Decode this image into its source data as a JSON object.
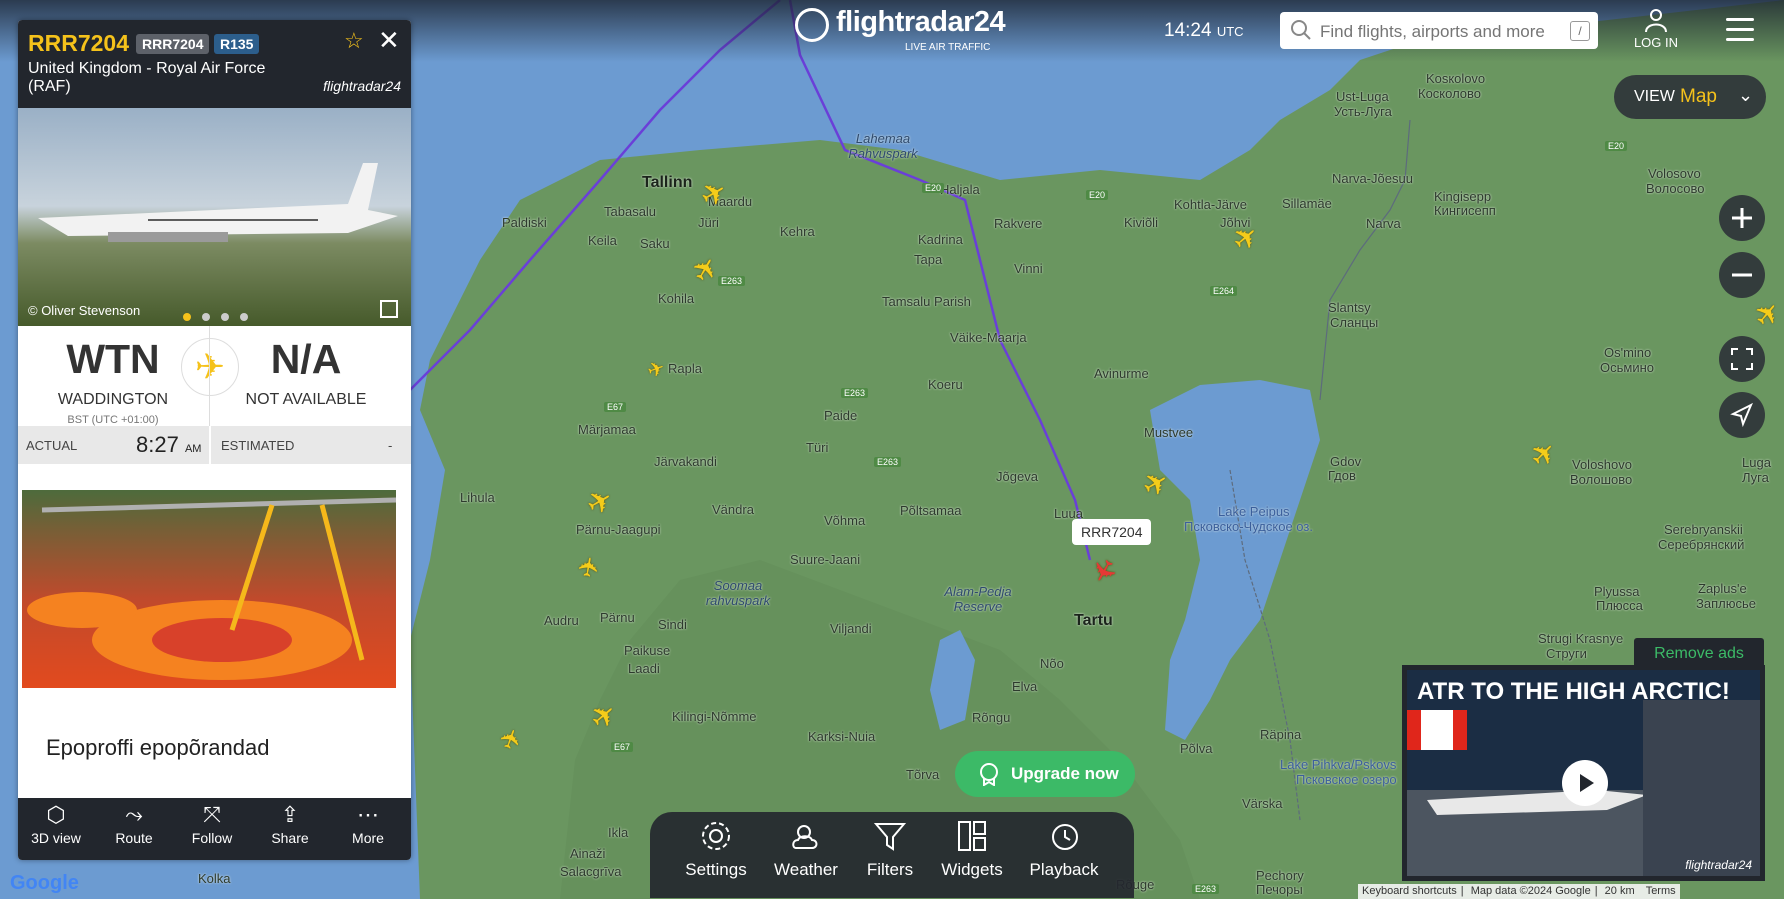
{
  "header": {
    "logo": "flightradar24",
    "logo_sub": "LIVE AIR TRAFFIC",
    "time": "14:24",
    "time_zone": "UTC",
    "search_placeholder": "Find flights, airports and more",
    "search_shortcut": "/",
    "login": "LOG IN"
  },
  "view": {
    "label": "VIEW",
    "value": "Map"
  },
  "flight": {
    "callsign": "RRR7204",
    "reg_tag": "RRR7204",
    "type_tag": "R135",
    "airline": "United Kingdom - Royal Air Force (RAF)",
    "brand": "flightradar24",
    "photo_credit": "© Oliver Stevenson",
    "origin": {
      "code": "WTN",
      "name": "WADDINGTON",
      "tz": "BST (UTC +01:00)"
    },
    "destination": {
      "code": "N/A",
      "name": "NOT AVAILABLE"
    },
    "actual_label": "ACTUAL",
    "actual_time": "8:27",
    "actual_ampm": "AM",
    "estimated_label": "ESTIMATED",
    "estimated_value": "-"
  },
  "ad": {
    "title": "Epoproffi epopõrandad"
  },
  "toolbar": [
    "3D view",
    "Route",
    "Follow",
    "Share",
    "More"
  ],
  "bottom_bar": [
    "Settings",
    "Weather",
    "Filters",
    "Widgets",
    "Playback"
  ],
  "upgrade": "Upgrade now",
  "video_ad": {
    "remove": "Remove ads",
    "title": "ATR TO THE HIGH ARCTIC!",
    "brand": "flightradar24"
  },
  "map": {
    "flight_label": "RRR7204",
    "places": [
      "Tallinn",
      "Maardu",
      "Jüri",
      "Paldiski",
      "Keila",
      "Saku",
      "Kehra",
      "Kohila",
      "Rapla",
      "Märjamaa",
      "Järvakandi",
      "Lihula",
      "Pärnu-Jaagupi",
      "Pärnu",
      "Audru",
      "Sindi",
      "Paikuse",
      "Laadi",
      "Kilingi-Nõmme",
      "Karksi-Nuia",
      "Viljandi",
      "Vändra",
      "Võhma",
      "Suure-Jaani",
      "Türi",
      "Paide",
      "Koeru",
      "Põltsamaa",
      "Jõgeva",
      "Mustvee",
      "Avinurme",
      "Väike-Maarja",
      "Tamsalu Parish",
      "Tapa",
      "Kadrina",
      "Vinni",
      "Rakvere",
      "Haljala",
      "Kiviõli",
      "Kohtla-Järve",
      "Jõhvi",
      "Sillamäe",
      "Narva-Jõesuu",
      "Narva",
      "Kingisepp",
      "Кингисепп",
      "Ust-Luga",
      "Усть-Луга",
      "Kosкolovo",
      "Косколово",
      "Volosovo",
      "Волосово",
      "Slantsy",
      "Сланцы",
      "Os'mino",
      "Осьмино",
      "Gdov",
      "Гдов",
      "Voloshovo",
      "Волошово",
      "Luga",
      "Луга",
      "Serebryanskii",
      "Серебрянский",
      "Plyussa",
      "Плюсса",
      "Zaplus'e",
      "Заплюсье",
      "Strugi Krasnye",
      "Струги",
      "Tartu",
      "Nõo",
      "Elva",
      "Rõngu",
      "Põlva",
      "Räpina",
      "Tõrva",
      "Ainaži",
      "Salacgrīva",
      "Ikla",
      "Värska",
      "Rõuge",
      "Pechory",
      "Печоры",
      "Kolka",
      "Lahemaa Rahvuspark",
      "Soomaa rahvuspark",
      "Alam-Pedja Reserve",
      "Lake Peipus",
      "Псковско-Чудское оз.",
      "Lake Pihkva/Pskovs",
      "Псковское озеро",
      "Tabasalu",
      "Luua"
    ],
    "roads": [
      "E20",
      "E20",
      "E20",
      "E263",
      "E263",
      "E263",
      "E264",
      "E67",
      "E67",
      "E263"
    ]
  },
  "attribution": [
    "Keyboard shortcuts",
    "Map data ©2024 Google",
    "20 km",
    "Terms"
  ],
  "google": "Google"
}
